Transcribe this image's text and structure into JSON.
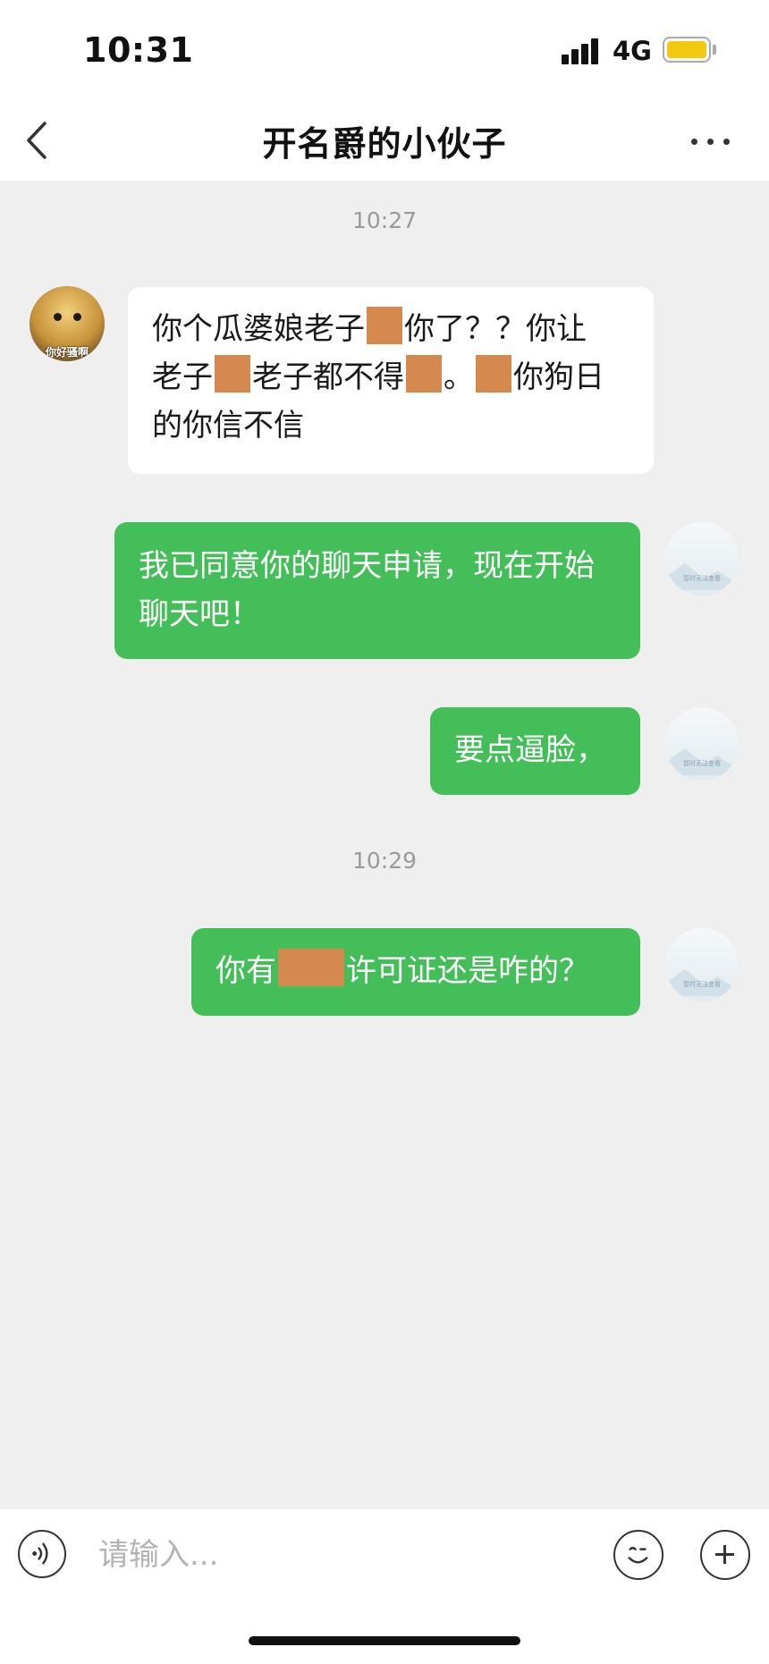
{
  "status_bar": {
    "time": "10:31",
    "network": "4G",
    "battery_color": "#f2c811"
  },
  "header": {
    "title": "开名爵的小伙子",
    "back_icon": "chevron-left-icon",
    "more_icon": "more-horizontal-icon"
  },
  "messages": [
    {
      "type": "timestamp",
      "text": "10:27"
    },
    {
      "type": "incoming",
      "avatar_caption": "你好骚啊",
      "lines": [
        [
          "你个瓜婆娘老子",
          "[redacted]",
          "你了？？你让"
        ],
        [
          "老子",
          "[redacted]",
          "老子都不得",
          "[redacted]",
          "。",
          "[redacted]",
          "你狗日"
        ],
        [
          "的你信不信"
        ]
      ]
    },
    {
      "type": "outgoing",
      "text": "我已同意你的聊天申请，现在开始聊天吧！",
      "avatar_caption": "暂时无法查看"
    },
    {
      "type": "outgoing",
      "text": "要点逼脸，",
      "avatar_caption": "暂时无法查看"
    },
    {
      "type": "timestamp",
      "text": "10:29"
    },
    {
      "type": "outgoing",
      "text_before": "你有",
      "text_after": "许可证还是咋的？",
      "avatar_caption": "暂时无法查看"
    }
  ],
  "input_bar": {
    "placeholder": "请输入...",
    "voice_icon": "voice-icon",
    "emoji_icon": "emoji-icon",
    "plus_icon": "plus-icon"
  },
  "colors": {
    "bubble_outgoing": "#43be58",
    "bubble_incoming": "#ffffff",
    "chat_background": "#efefef",
    "redaction": "#d6894f"
  }
}
